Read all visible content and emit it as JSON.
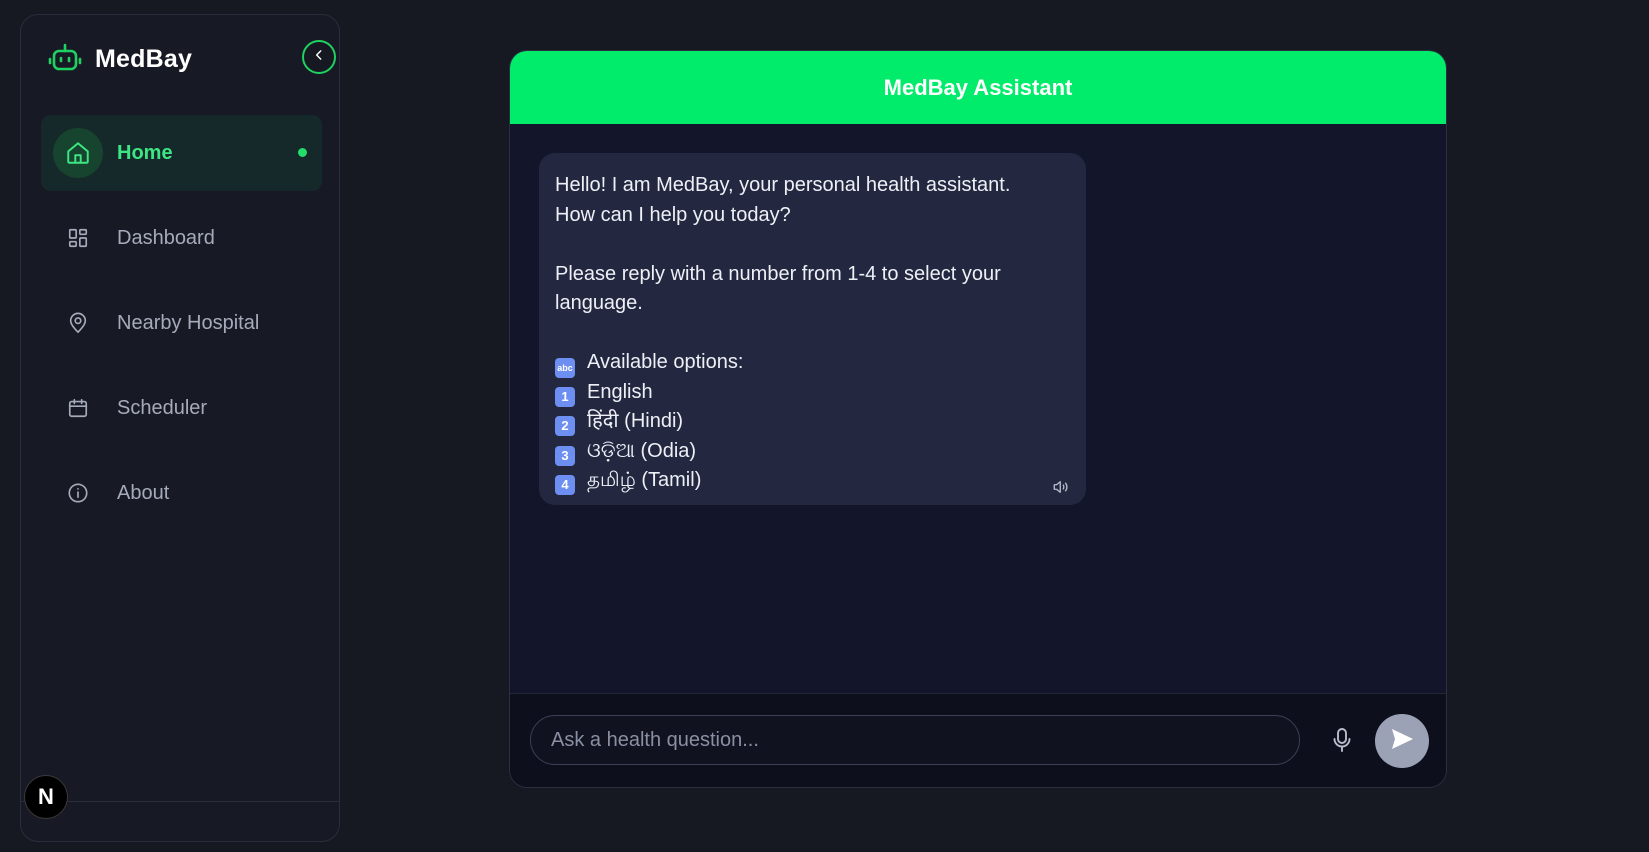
{
  "brand": {
    "name": "MedBay",
    "icon": "robot-icon",
    "accent": "#1fd160"
  },
  "sidebar": {
    "items": [
      {
        "label": "Home",
        "icon": "home-icon",
        "active": true
      },
      {
        "label": "Dashboard",
        "icon": "dashboard-icon",
        "active": false
      },
      {
        "label": "Nearby Hospital",
        "icon": "map-pin-icon",
        "active": false
      },
      {
        "label": "Scheduler",
        "icon": "calendar-icon",
        "active": false
      },
      {
        "label": "About",
        "icon": "info-icon",
        "active": false
      }
    ],
    "footer_badge": "N"
  },
  "chat": {
    "title": "MedBay Assistant",
    "header_color": "#00ec6a",
    "message": {
      "lines": [
        "Hello! I am MedBay, your personal health assistant.",
        "How can I help you today?",
        "",
        "Please reply with a number from 1-4 to select your",
        "language.",
        ""
      ],
      "options_heading": "Available options:",
      "options_heading_icon": "abc",
      "options": [
        {
          "key": "1",
          "text": "English"
        },
        {
          "key": "2",
          "text": "हिंदी (Hindi)"
        },
        {
          "key": "3",
          "text": "ଓଡ଼ିଆ (Odia)"
        },
        {
          "key": "4",
          "text": "தமிழ் (Tamil)"
        }
      ]
    },
    "input": {
      "placeholder": "Ask a health question...",
      "value": ""
    }
  }
}
